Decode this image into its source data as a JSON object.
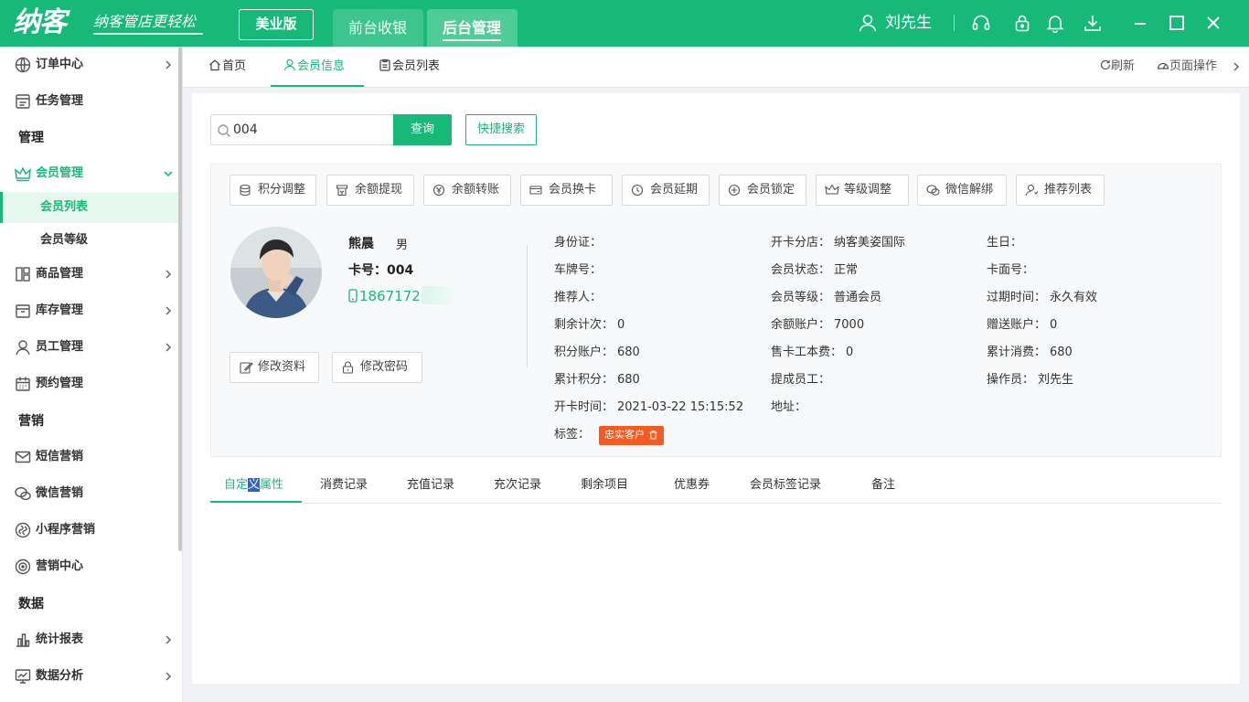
{
  "header": {
    "logo": "纳客",
    "slogan": "纳客管店更轻松",
    "edition": "美业版",
    "nav": [
      "前台收银",
      "后台管理"
    ],
    "user": "刘先生"
  },
  "sidebar": {
    "items": [
      {
        "label": "订单中心"
      },
      {
        "label": "任务管理"
      }
    ],
    "group_manage": "管理",
    "member_mgmt": "会员管理",
    "member_list": "会员列表",
    "member_level": "会员等级",
    "items2": [
      {
        "label": "商品管理"
      },
      {
        "label": "库存管理"
      },
      {
        "label": "员工管理"
      },
      {
        "label": "预约管理"
      }
    ],
    "group_marketing": "营销",
    "items3": [
      {
        "label": "短信营销"
      },
      {
        "label": "微信营销"
      },
      {
        "label": "小程序营销"
      },
      {
        "label": "营销中心"
      }
    ],
    "group_data": "数据",
    "items4": [
      {
        "label": "统计报表"
      },
      {
        "label": "数据分析"
      }
    ]
  },
  "tabs": {
    "home": "首页",
    "member_info": "会员信息",
    "member_list": "会员列表",
    "refresh": "刷新",
    "page_ops": "页面操作"
  },
  "search": {
    "value": "004",
    "button": "查询",
    "quick": "快捷搜索"
  },
  "actions": [
    "积分调整",
    "余额提现",
    "余额转账",
    "会员换卡",
    "会员延期",
    "会员锁定",
    "等级调整",
    "微信解绑",
    "推荐列表"
  ],
  "member": {
    "name": "熊晨",
    "gender": "男",
    "card_no": "卡号：004",
    "phone": "1867172",
    "edit_profile": "修改资料",
    "edit_password": "修改密码"
  },
  "fields": {
    "col1": [
      {
        "label": "身份证：",
        "value": ""
      },
      {
        "label": "车牌号：",
        "value": ""
      },
      {
        "label": "推荐人：",
        "value": ""
      },
      {
        "label": "剩余计次：",
        "value": "0"
      },
      {
        "label": "积分账户：",
        "value": "680"
      },
      {
        "label": "累计积分：",
        "value": "680"
      },
      {
        "label": "开卡时间：",
        "value": "2021-03-22 15:15:52"
      }
    ],
    "tag_label": "标签：",
    "tag": "忠实客户",
    "col2": [
      {
        "label": "开卡分店：",
        "value": "纳客美姿国际"
      },
      {
        "label": "会员状态：",
        "value": "正常"
      },
      {
        "label": "会员等级：",
        "value": "普通会员"
      },
      {
        "label": "余额账户：",
        "value": "7000"
      },
      {
        "label": "售卡工本费：",
        "value": "0"
      },
      {
        "label": "提成员工：",
        "value": ""
      },
      {
        "label": "地址：",
        "value": ""
      }
    ],
    "col3": [
      {
        "label": "生日：",
        "value": ""
      },
      {
        "label": "卡面号：",
        "value": ""
      },
      {
        "label": "过期时间：",
        "value": "永久有效"
      },
      {
        "label": "赠送账户：",
        "value": "0"
      },
      {
        "label": "累计消费：",
        "value": "680"
      },
      {
        "label": "操作员：",
        "value": "刘先生"
      }
    ]
  },
  "detail_tabs": {
    "custom_a": "自定",
    "custom_b": "义",
    "custom_c": "属性",
    "others": [
      "消费记录",
      "充值记录",
      "充次记录",
      "剩余项目",
      "优惠券",
      "会员标签记录",
      "备注"
    ]
  }
}
